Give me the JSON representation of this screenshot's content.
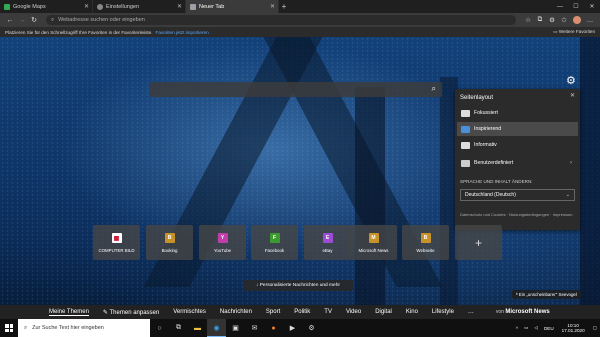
{
  "tabs": [
    {
      "label": "Google Maps",
      "color": "#34a853"
    },
    {
      "label": "Einstellungen",
      "color": "#888888"
    },
    {
      "label": "Neuer Tab",
      "color": "#9aa0a6",
      "active": true
    }
  ],
  "address": {
    "placeholder": "Webadresse suchen oder eingeben"
  },
  "favbar": {
    "text": "Platzieren Sie für den Schnellzugriff Ihre Favoriten in der Favoritenleiste.",
    "link": "Favoriten jetzt importieren",
    "other": "Weitere Favoriten"
  },
  "panel": {
    "title": "Seitenlayout",
    "options": [
      {
        "label": "Fokussiert",
        "icon": "focused-layout-icon"
      },
      {
        "label": "Inspirierend",
        "icon": "inspirational-layout-icon",
        "selected": true
      },
      {
        "label": "Informativ",
        "icon": "informational-layout-icon"
      },
      {
        "label": "Benutzerdefiniert",
        "icon": "custom-layout-icon"
      }
    ],
    "lang_label": "SPRACHE UND INHALT ÄNDERN:",
    "lang_value": "Deutschland (Deutsch)",
    "privacy": "Datenschutz und Cookies · Nutzungsbedingungen · Impressum"
  },
  "tiles": [
    {
      "label": "COMPUTER BILD",
      "logo": "",
      "color": "#c8102e"
    },
    {
      "label": "Booking",
      "logo": "B",
      "color": "#c8922a"
    },
    {
      "label": "YouTube",
      "logo": "Y",
      "color": "#c03ea8"
    },
    {
      "label": "Facebook",
      "logo": "F",
      "color": "#3c9a2e"
    },
    {
      "label": "eBay",
      "logo": "E",
      "color": "#9b4bd4"
    },
    {
      "label": "Microsoft News",
      "logo": "M",
      "color": "#c8922a"
    },
    {
      "label": "Webseite",
      "logo": "B",
      "color": "#c8922a"
    }
  ],
  "personalized_button": "Personalisierte Nachrichten und mehr",
  "image_credit": "Ein „unscheinbarer\" Seevogel",
  "news_nav": [
    "Meine Themen",
    "Themen anpassen",
    "Vermischtes",
    "Nachrichten",
    "Sport",
    "Politik",
    "TV",
    "Video",
    "Digital",
    "Kino",
    "Lifestyle",
    "…"
  ],
  "msn": {
    "prefix": "von",
    "brand": "Microsoft News"
  },
  "taskbar": {
    "search_placeholder": "Zur Suche Text hier eingeben",
    "lang": "DEU",
    "time": "10:10",
    "date": "17.01.2020"
  }
}
